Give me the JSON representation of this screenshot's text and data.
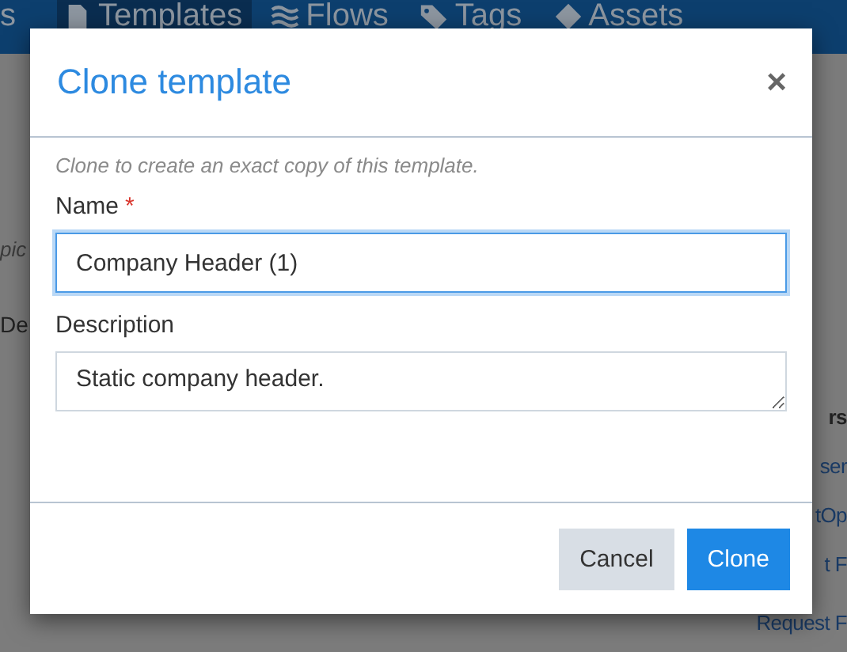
{
  "nav": {
    "items": [
      {
        "label": "s",
        "kind": "plain",
        "selected": false
      },
      {
        "label": "Templates",
        "kind": "document",
        "selected": true
      },
      {
        "label": "Flows",
        "kind": "waves",
        "selected": false
      },
      {
        "label": "Tags",
        "kind": "tag",
        "selected": false
      },
      {
        "label": "Assets",
        "kind": "diamond",
        "selected": false
      }
    ]
  },
  "background": {
    "left": [
      "pic",
      "De"
    ],
    "right": [
      "rs",
      "ser",
      "tOp",
      "t F",
      "Request F"
    ]
  },
  "dialog": {
    "title": "Clone template",
    "close": "×",
    "hint": "Clone to create an exact copy of this template.",
    "fields": [
      {
        "label": "Name",
        "required_mark": "*",
        "kind": "input",
        "value": "Company Header (1)",
        "focused": true
      },
      {
        "label": "Description",
        "kind": "textarea",
        "value": "Static company header.",
        "focused": false
      }
    ],
    "buttons": [
      {
        "label": "Cancel",
        "kind": "secondary"
      },
      {
        "label": "Clone",
        "kind": "primary"
      }
    ]
  }
}
